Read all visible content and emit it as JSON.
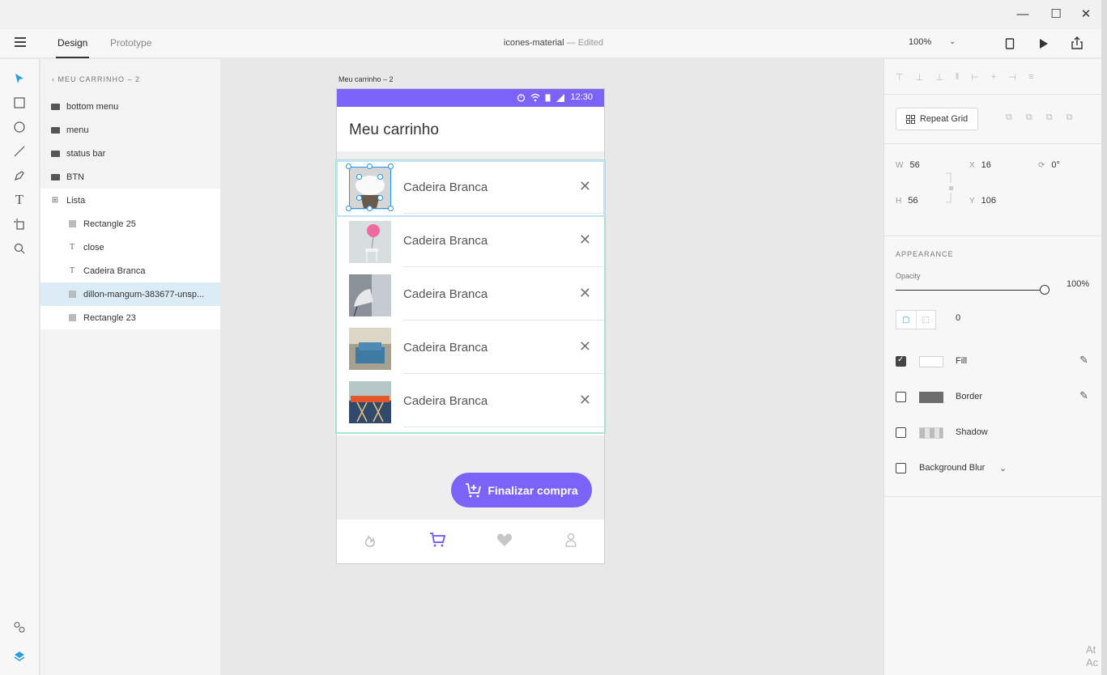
{
  "window": {
    "minimize": "—",
    "maximize": "☐",
    "close": "✕"
  },
  "toolbar": {
    "tabs": [
      {
        "label": "Design",
        "active": true
      },
      {
        "label": "Prototype",
        "active": false
      }
    ],
    "document_name": "icones-material",
    "separator": "—",
    "document_status": "Edited",
    "zoom": "100%",
    "zoom_chevron": "⌄"
  },
  "tools": [
    "select-arrow-icon",
    "rectangle-icon",
    "ellipse-icon",
    "line-icon",
    "pen-icon",
    "text-icon",
    "artboard-icon",
    "zoom-icon"
  ],
  "layers": {
    "header": "‹ MEU CARRINHO – 2",
    "items": [
      {
        "label": "bottom menu",
        "icon": "folder-icon",
        "indent": 0
      },
      {
        "label": "menu",
        "icon": "folder-icon",
        "indent": 0
      },
      {
        "label": "status bar",
        "icon": "folder-icon",
        "indent": 0
      },
      {
        "label": "BTN",
        "icon": "folder-icon",
        "indent": 0
      },
      {
        "label": "Lista",
        "icon": "repeat-grid-icon",
        "indent": 0
      },
      {
        "label": "Rectangle 25",
        "icon": "rectangle-icon",
        "indent": 1
      },
      {
        "label": "close",
        "icon": "text-icon",
        "indent": 1
      },
      {
        "label": "Cadeira Branca",
        "icon": "text-icon",
        "indent": 1
      },
      {
        "label": "dillon-mangum-383677-unsp...",
        "icon": "image-icon",
        "indent": 1,
        "selected": true
      },
      {
        "label": "Rectangle 23",
        "icon": "rectangle-icon",
        "indent": 1
      }
    ]
  },
  "artboard": {
    "label": "Meu carrinho – 2",
    "status_time": "12:30",
    "app_title": "Meu carrinho",
    "items": [
      {
        "name": "Cadeira Branca",
        "close": "✕"
      },
      {
        "name": "Cadeira Branca",
        "close": "✕"
      },
      {
        "name": "Cadeira Branca",
        "close": "✕"
      },
      {
        "name": "Cadeira Branca",
        "close": "✕"
      },
      {
        "name": "Cadeira Branca",
        "close": "✕"
      }
    ],
    "fab_label": "Finalizar compra",
    "accent_color": "#7b63f7"
  },
  "properties": {
    "repeat_grid": "Repeat Grid",
    "w_label": "W",
    "w_value": "56",
    "h_label": "H",
    "h_value": "56",
    "x_label": "X",
    "x_value": "16",
    "y_label": "Y",
    "y_value": "106",
    "rotation": "0°",
    "appearance_header": "APPEARANCE",
    "opacity_label": "Opacity",
    "opacity_value": "100%",
    "opacity_level": 1.0,
    "corner_radius": "0",
    "fill": {
      "label": "Fill",
      "checked": true
    },
    "border": {
      "label": "Border",
      "checked": false
    },
    "shadow": {
      "label": "Shadow",
      "checked": false
    },
    "background_blur": {
      "label": "Background Blur",
      "checked": false,
      "chevron": "⌄"
    }
  },
  "watermark": {
    "line1": "At",
    "line2": "Ac"
  }
}
